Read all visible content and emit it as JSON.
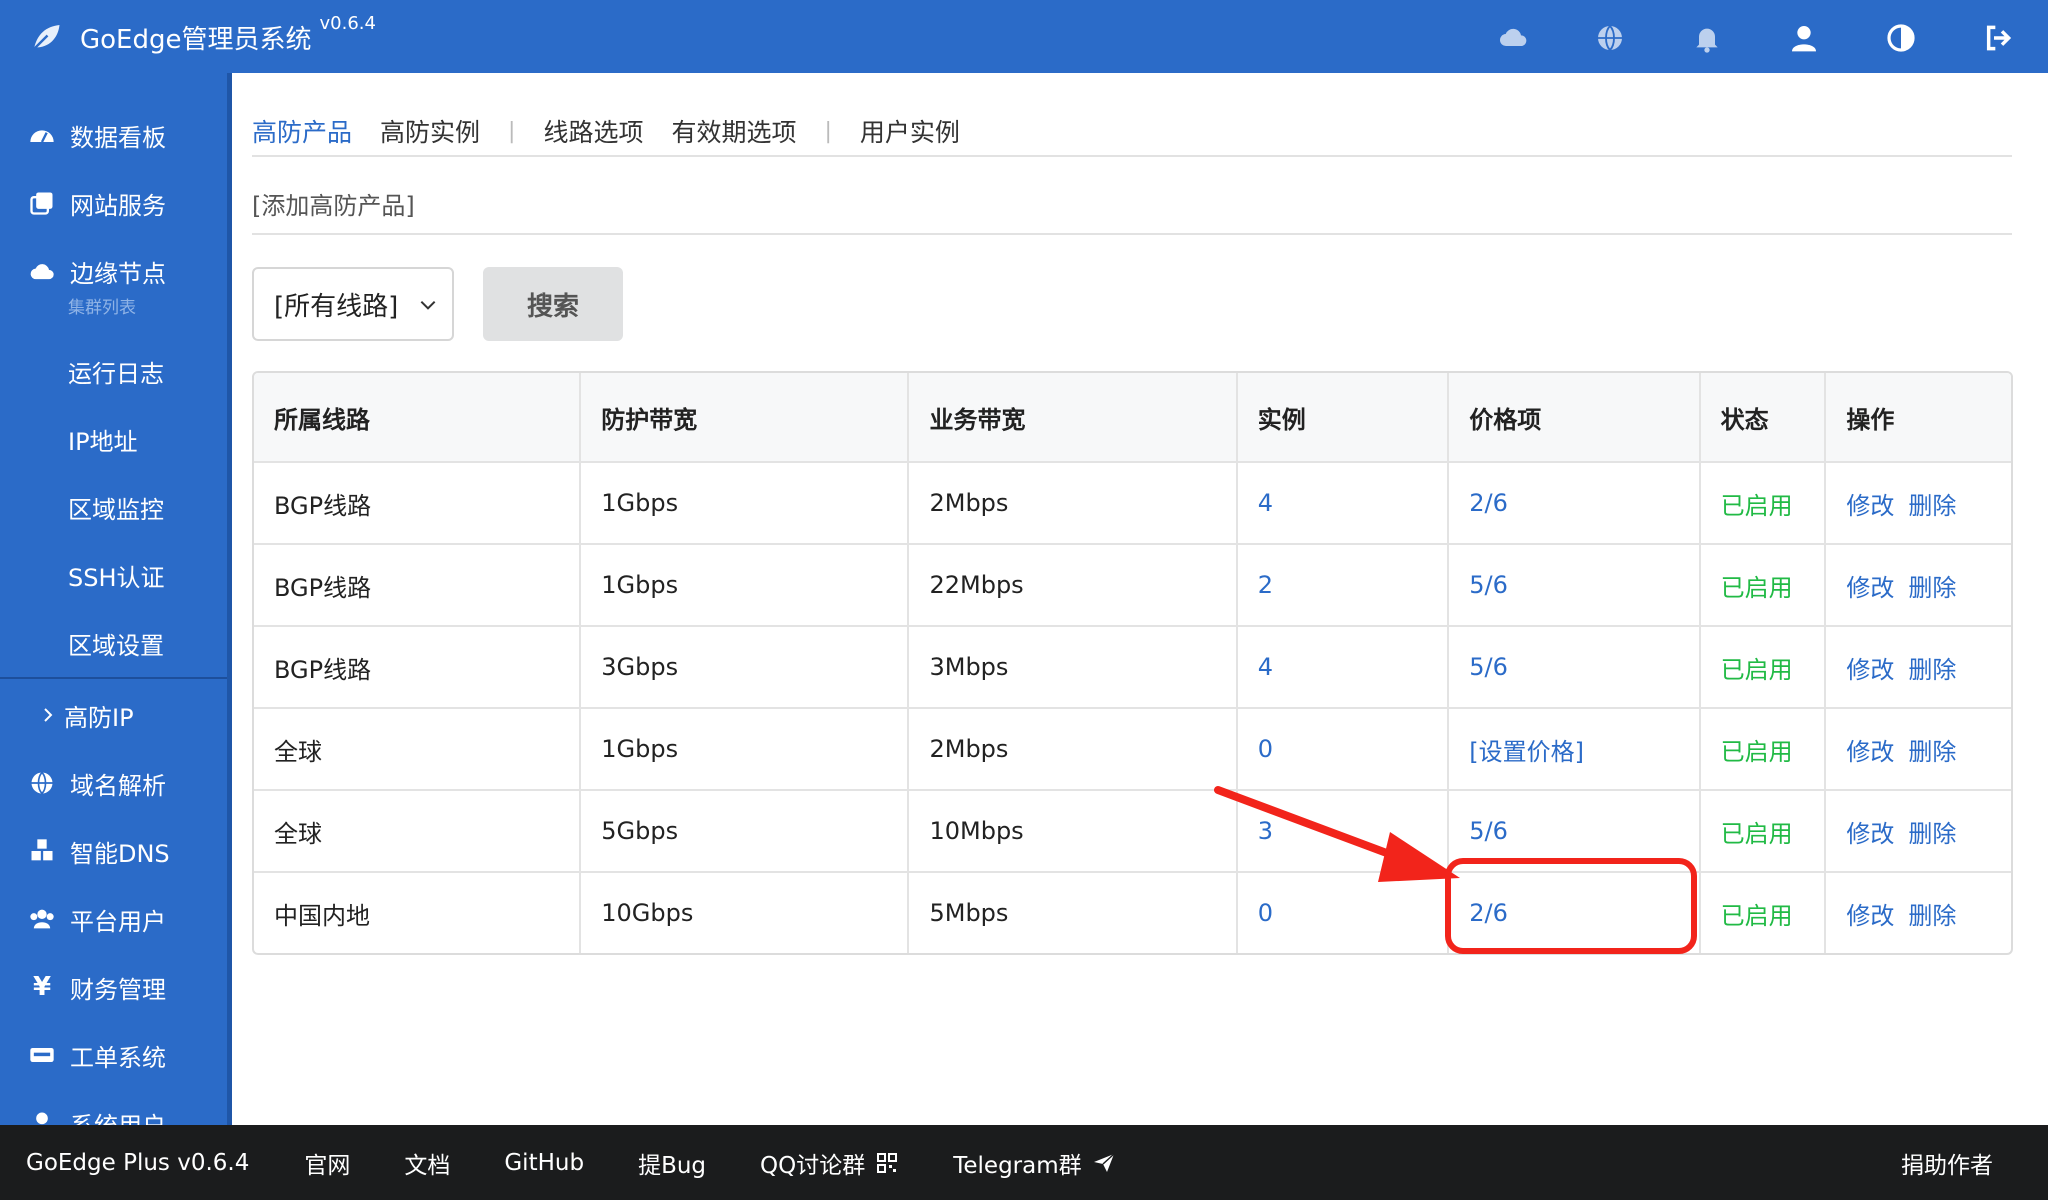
{
  "app": {
    "title": "GoEdge管理员系统",
    "version": "v0.6.4"
  },
  "top_icons": [
    "cloud-icon",
    "globe-icon",
    "bell-icon",
    "user-icon",
    "contrast-icon",
    "logout-icon"
  ],
  "sidebar": {
    "items": [
      {
        "label": "数据看板",
        "icon": "dashboard-icon"
      },
      {
        "label": "网站服务",
        "icon": "copy-icon"
      },
      {
        "label": "边缘节点",
        "icon": "cloud-icon",
        "caption": "集群列表"
      },
      {
        "label": "运行日志"
      },
      {
        "label": "IP地址"
      },
      {
        "label": "区域监控"
      },
      {
        "label": "SSH认证"
      },
      {
        "label": "区域设置"
      },
      {
        "label": "高防IP",
        "icon": "chevron-right-icon"
      },
      {
        "label": "域名解析",
        "icon": "globe-icon"
      },
      {
        "label": "智能DNS",
        "icon": "cubes-icon"
      },
      {
        "label": "平台用户",
        "icon": "users-icon"
      },
      {
        "label": "财务管理",
        "icon": "yen-icon"
      },
      {
        "label": "工单系统",
        "icon": "keyboard-icon"
      },
      {
        "label": "系统用户",
        "icon": "user-icon"
      }
    ]
  },
  "tabs": {
    "t1": "高防产品",
    "t2": "高防实例",
    "t3": "线路选项",
    "t4": "有效期选项",
    "t5": "用户实例",
    "sep": "|"
  },
  "actions": {
    "add": "[添加高防产品]"
  },
  "filter": {
    "selected": "[所有线路]",
    "search_label": "搜索"
  },
  "table": {
    "headers": [
      "所属线路",
      "防护带宽",
      "业务带宽",
      "实例",
      "价格项",
      "状态",
      "操作"
    ],
    "rows": [
      {
        "line": "BGP线路",
        "protect": "1Gbps",
        "service": "2Mbps",
        "instances": "4",
        "price": "2/6",
        "status": "已启用"
      },
      {
        "line": "BGP线路",
        "protect": "1Gbps",
        "service": "22Mbps",
        "instances": "2",
        "price": "5/6",
        "status": "已启用"
      },
      {
        "line": "BGP线路",
        "protect": "3Gbps",
        "service": "3Mbps",
        "instances": "4",
        "price": "5/6",
        "status": "已启用"
      },
      {
        "line": "全球",
        "protect": "1Gbps",
        "service": "2Mbps",
        "instances": "0",
        "price": "[设置价格]",
        "status": "已启用"
      },
      {
        "line": "全球",
        "protect": "5Gbps",
        "service": "10Mbps",
        "instances": "3",
        "price": "5/6",
        "status": "已启用"
      },
      {
        "line": "中国内地",
        "protect": "10Gbps",
        "service": "5Mbps",
        "instances": "0",
        "price": "2/6",
        "status": "已启用"
      }
    ],
    "op_edit": "修改",
    "op_delete": "删除"
  },
  "footer": {
    "product": "GoEdge Plus v0.6.4",
    "links": [
      "官网",
      "文档",
      "GitHub",
      "提Bug",
      "QQ讨论群",
      "Telegram群"
    ],
    "donate": "捐助作者"
  },
  "colors": {
    "primary": "#2b6bc8",
    "success": "#21ba45",
    "annotation": "#f2241b",
    "footer_bg": "#1b1c1d"
  }
}
